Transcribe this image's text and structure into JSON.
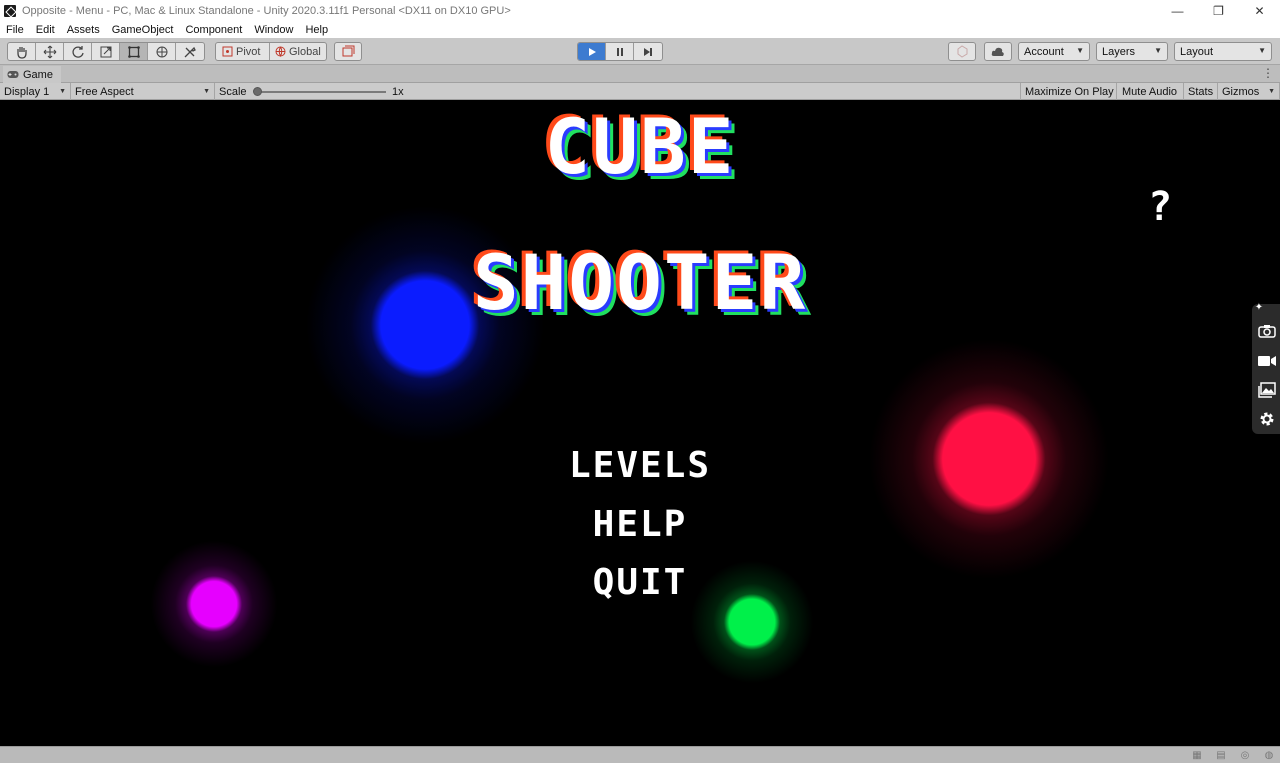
{
  "window": {
    "title": "Opposite - Menu - PC, Mac & Linux Standalone - Unity 2020.3.11f1 Personal <DX11 on DX10 GPU>",
    "controls": [
      "—",
      "❐",
      "✕"
    ]
  },
  "menu": [
    "File",
    "Edit",
    "Assets",
    "GameObject",
    "Component",
    "Window",
    "Help"
  ],
  "toolbar": {
    "tools": [
      "hand-icon",
      "move-icon",
      "rotate-icon",
      "scale-icon",
      "rect-icon",
      "transform-icon",
      "custom-tool-icon"
    ],
    "pivot_label": "Pivot",
    "global_label": "Global",
    "account_label": "Account",
    "layers_label": "Layers",
    "layout_label": "Layout"
  },
  "tab": {
    "label": "Game"
  },
  "game_bar": {
    "display": "Display 1",
    "aspect": "Free Aspect",
    "scale_label": "Scale",
    "scale_value": "1x",
    "scale_fraction": 0.0,
    "maximize": "Maximize On Play",
    "mute": "Mute Audio",
    "stats": "Stats",
    "gizmos": "Gizmos"
  },
  "game": {
    "title_line1": "CUBE",
    "title_line2": "SHOOTER",
    "menu_levels": "LEVELS",
    "menu_help": "HELP",
    "menu_quit": "QUIT",
    "help_glyph": "?",
    "orb_colors": {
      "blue": "#0b1cff",
      "red": "#ff1044",
      "magenta": "#e600ff",
      "green": "#00f04a"
    },
    "title_accent_colors": [
      "#ff4a1a",
      "#2a3cff",
      "#20e060"
    ]
  },
  "side_tools": [
    "camera-icon",
    "video-icon",
    "gallery-icon",
    "settings-icon"
  ]
}
